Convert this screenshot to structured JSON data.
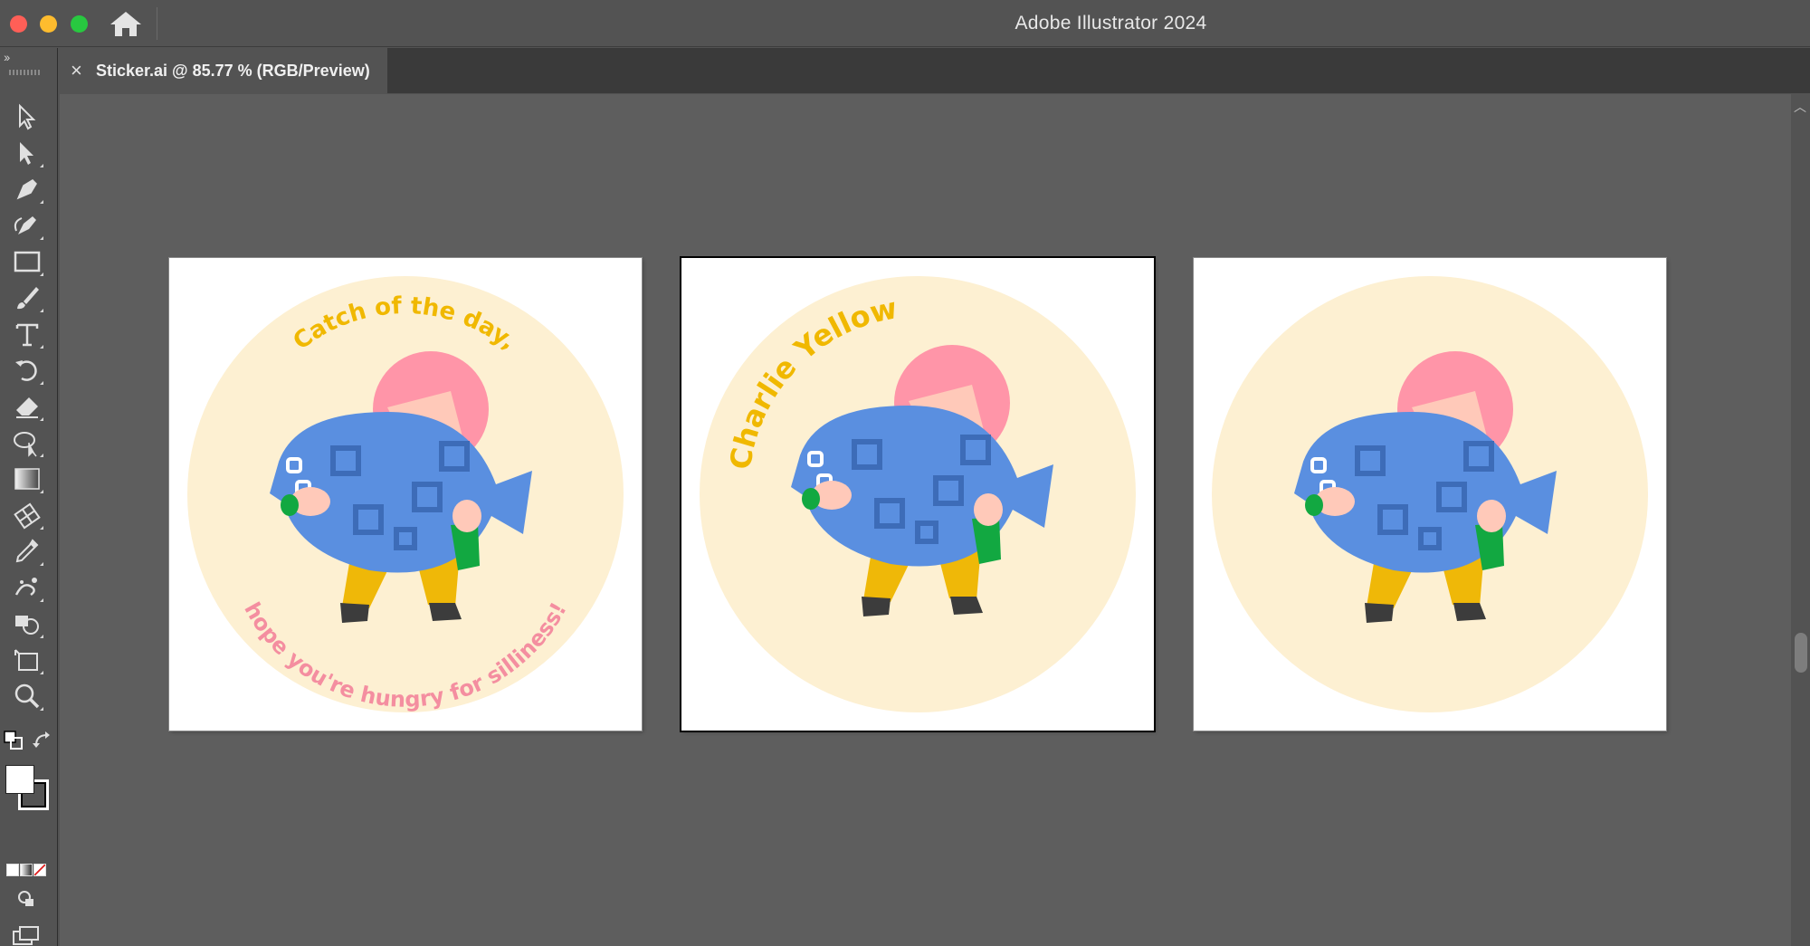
{
  "window": {
    "app_title": "Adobe Illustrator 2024"
  },
  "tabs": [
    {
      "label": "Sticker.ai @ 85.77 % (RGB/Preview)",
      "close_glyph": "×"
    }
  ],
  "toolbar": {
    "collapse_glyph": "››",
    "tools": [
      {
        "name": "selection-tool-icon"
      },
      {
        "name": "direct-selection-tool-icon"
      },
      {
        "name": "pen-tool-icon"
      },
      {
        "name": "curvature-tool-icon"
      },
      {
        "name": "rectangle-tool-icon"
      },
      {
        "name": "paintbrush-tool-icon"
      },
      {
        "name": "type-tool-icon"
      },
      {
        "name": "rotate-tool-icon"
      },
      {
        "name": "eraser-tool-icon"
      },
      {
        "name": "lasso-tool-icon"
      },
      {
        "name": "gradient-tool-icon"
      },
      {
        "name": "mesh-tool-icon"
      },
      {
        "name": "eyedropper-tool-icon"
      },
      {
        "name": "symbol-sprayer-tool-icon"
      },
      {
        "name": "shape-builder-tool-icon"
      },
      {
        "name": "artboard-tool-icon"
      },
      {
        "name": "zoom-tool-icon"
      }
    ],
    "more_glyph": "•••"
  },
  "artboards": [
    {
      "top_text": "Catch of the day,",
      "bottom_text": "hope you're hungry for silliness!",
      "active": false
    },
    {
      "top_text": "Charlie Yellow",
      "bottom_text": "",
      "active": true
    },
    {
      "top_text": "",
      "bottom_text": "",
      "active": false
    }
  ],
  "colors": {
    "sticker_bg": "#fdf0d2",
    "yellow_text": "#f0b800",
    "pink_text": "#f48ea0",
    "hair": "#ff95a8",
    "face": "#ffc9b9",
    "fish": "#5a8fe0",
    "fish_dark": "#3d6cb8",
    "pants": "#efb808",
    "sleeve": "#12a841",
    "shoe": "#3c3c3c"
  }
}
